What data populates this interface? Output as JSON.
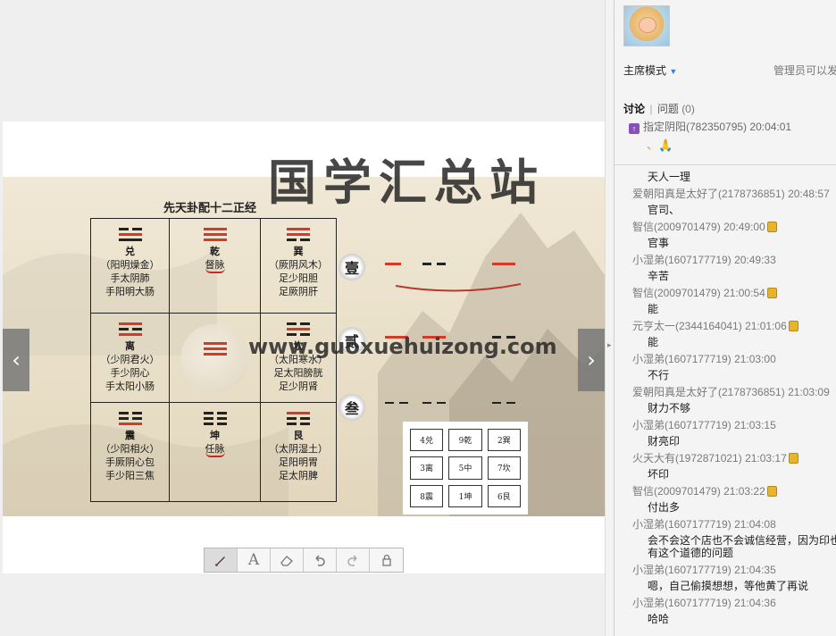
{
  "slide": {
    "title": "先天卦配十二正经",
    "cells": [
      {
        "name": "兑",
        "lines": [
          "（阳明燥金）",
          "手太阴肺",
          "手阳明大肠"
        ]
      },
      {
        "name": "乾",
        "lines": [
          "督脉"
        ]
      },
      {
        "name": "巽",
        "lines": [
          "（厥阴风木）",
          "足少阳胆",
          "足厥阴肝"
        ]
      },
      {
        "name": "离",
        "lines": [
          "（少阴君火）",
          "手少阴心",
          "手太阳小肠"
        ]
      },
      {
        "name": "坎",
        "lines": [
          "（太阳寒水）",
          "足太阳膀胱",
          "足少阴肾"
        ]
      },
      {
        "name": "震",
        "lines": [
          "（少阳相火）",
          "手厥阴心包",
          "手少阳三焦"
        ]
      },
      {
        "name": "坤",
        "lines": [
          "任脉"
        ]
      },
      {
        "name": "艮",
        "lines": [
          "（太阴湿土）",
          "足阳明胃",
          "足太阴脾"
        ]
      }
    ],
    "seals": [
      "壹",
      "贰",
      "叁"
    ],
    "mini_grid": [
      "4兑",
      "9乾",
      "2巽",
      "3离",
      "5中",
      "7坎",
      "8震",
      "1坤",
      "6艮"
    ],
    "watermark_cn": "国学汇总站",
    "watermark_url": "www.guoxuehuizong.com"
  },
  "toolbar": {
    "tools": [
      "brush",
      "text",
      "eraser",
      "undo",
      "redo",
      "lock"
    ],
    "text_tool_glyph": "A"
  },
  "panel": {
    "mode_label": "主席模式",
    "admin_text": "管理员可以发",
    "tab_discussion": "讨论",
    "tab_questions": "问题",
    "questions_count": "(0)",
    "pinned": "指定阴阳(782350795) 20:04:01",
    "pinned_content": "、🙏"
  },
  "messages": [
    {
      "who": "",
      "body": "天人一理"
    },
    {
      "who": "爱朝阳真是太好了(2178736851) 20:48:57",
      "body": "官司、"
    },
    {
      "who": "智信(2009701479) 20:49:00",
      "badge": true,
      "body": "官事"
    },
    {
      "who": "小湿弟(1607177719) 20:49:33",
      "body": "辛苦"
    },
    {
      "who": "智信(2009701479) 21:00:54",
      "badge": true,
      "body": "能"
    },
    {
      "who": "元亨太一(2344164041) 21:01:06",
      "badge": true,
      "body": "能"
    },
    {
      "who": "小湿弟(1607177719) 21:03:00",
      "body": "不行"
    },
    {
      "who": "爱朝阳真是太好了(2178736851) 21:03:09",
      "body": "财力不够"
    },
    {
      "who": "小湿弟(1607177719) 21:03:15",
      "body": "财亮印"
    },
    {
      "who": "火天大有(1972871021) 21:03:17",
      "badge": true,
      "body": "坏印"
    },
    {
      "who": "智信(2009701479) 21:03:22",
      "badge": true,
      "body": "付出多"
    },
    {
      "who": "小湿弟(1607177719) 21:04:08",
      "body": "会不会这个店也不会诚信经营，因为印也",
      "body2": "有这个道德的问题"
    },
    {
      "who": "小湿弟(1607177719) 21:04:35",
      "body": "嗯，自己偷摸想想，等他黄了再说"
    },
    {
      "who": "小湿弟(1607177719) 21:04:36",
      "body": "哈哈"
    }
  ],
  "colors": {
    "accent": "#3a7bd5",
    "seal_red": "#d33a2a",
    "badge": "#e8b52a"
  }
}
